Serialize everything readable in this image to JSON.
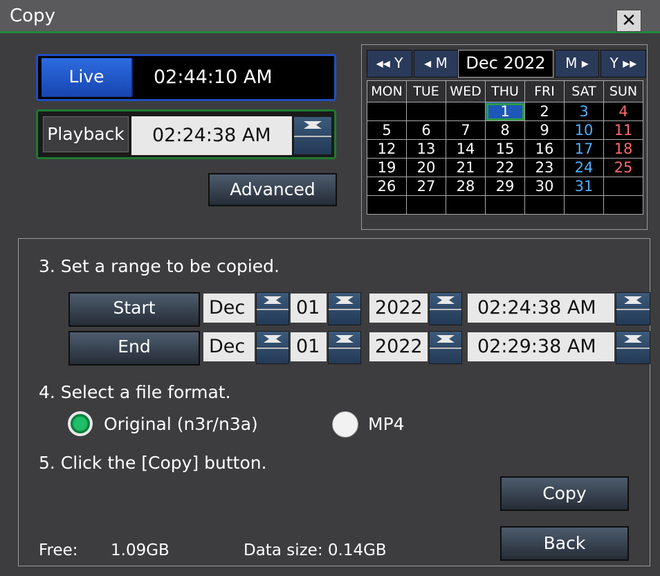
{
  "window": {
    "title": "Copy",
    "close_icon": "close-icon"
  },
  "live": {
    "label": "Live",
    "time": "02:44:10 AM"
  },
  "playback": {
    "label": "Playback",
    "time": "02:24:38 AM"
  },
  "advanced_label": "Advanced",
  "calendar": {
    "prev_year": "◂◂ Y",
    "prev_month": "◂ M",
    "month_label": "Dec 2022",
    "next_month": "M ▸",
    "next_year": "Y ▸▸",
    "weekdays": [
      "MON",
      "TUE",
      "WED",
      "THU",
      "FRI",
      "SAT",
      "SUN"
    ],
    "weeks": [
      [
        "",
        "",
        "",
        "1",
        "2",
        "3",
        "4"
      ],
      [
        "5",
        "6",
        "7",
        "8",
        "9",
        "10",
        "11"
      ],
      [
        "12",
        "13",
        "14",
        "15",
        "16",
        "17",
        "18"
      ],
      [
        "19",
        "20",
        "21",
        "22",
        "23",
        "24",
        "25"
      ],
      [
        "26",
        "27",
        "28",
        "29",
        "30",
        "31",
        ""
      ],
      [
        "",
        "",
        "",
        "",
        "",
        "",
        ""
      ]
    ],
    "selected_day": "1"
  },
  "steps": {
    "step3": "3. Set a range to be copied.",
    "step4": "4. Select a file format.",
    "step5": "5. Click the [Copy] button."
  },
  "range": {
    "start": {
      "label": "Start",
      "month": "Dec",
      "day": "01",
      "year": "2022",
      "time": "02:24:38 AM"
    },
    "end": {
      "label": "End",
      "month": "Dec",
      "day": "01",
      "year": "2022",
      "time": "02:29:38 AM"
    }
  },
  "format": {
    "options": [
      {
        "label": "Original (n3r/n3a)",
        "selected": true
      },
      {
        "label": "MP4",
        "selected": false
      }
    ]
  },
  "buttons": {
    "copy": "Copy",
    "back": "Back"
  },
  "status": {
    "free_label": "Free:",
    "free_value": "1.09GB",
    "data_size": "Data size: 0.14GB"
  },
  "colors": {
    "accent_green": "#1e8a3c",
    "live_blue": "#1f4fbf",
    "saturday": "#4fb0ff",
    "sunday": "#ff6a6a"
  }
}
